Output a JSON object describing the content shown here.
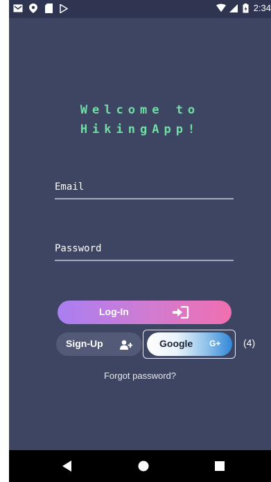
{
  "status_bar": {
    "time": "2:34",
    "icons": [
      "gmail-icon",
      "location-icon",
      "clipboard-icon",
      "play-store-icon",
      "wifi-icon",
      "signal-icon",
      "battery-icon"
    ]
  },
  "welcome": {
    "line1": "Welcome to",
    "line2": "HikingApp!",
    "color": "#6fe0a4"
  },
  "form": {
    "email_label": "Email",
    "password_label": "Password"
  },
  "buttons": {
    "login_label": "Log-In",
    "login_icon": "sign-in-icon",
    "signup_label": "Sign-Up",
    "signup_icon": "add-user-icon",
    "google_label": "Google",
    "google_icon_text": "G+",
    "google_badge": "(4)"
  },
  "links": {
    "forgot_password": "Forgot password?"
  },
  "nav": {
    "icons": [
      "back-icon",
      "home-icon",
      "recents-icon"
    ]
  },
  "colors": {
    "background": "#3e4562",
    "accent_green": "#6fe0a4",
    "login_gradient_start": "#a97ff2",
    "login_gradient_end": "#f06fb0",
    "google_gradient_end": "#2f86d8"
  }
}
